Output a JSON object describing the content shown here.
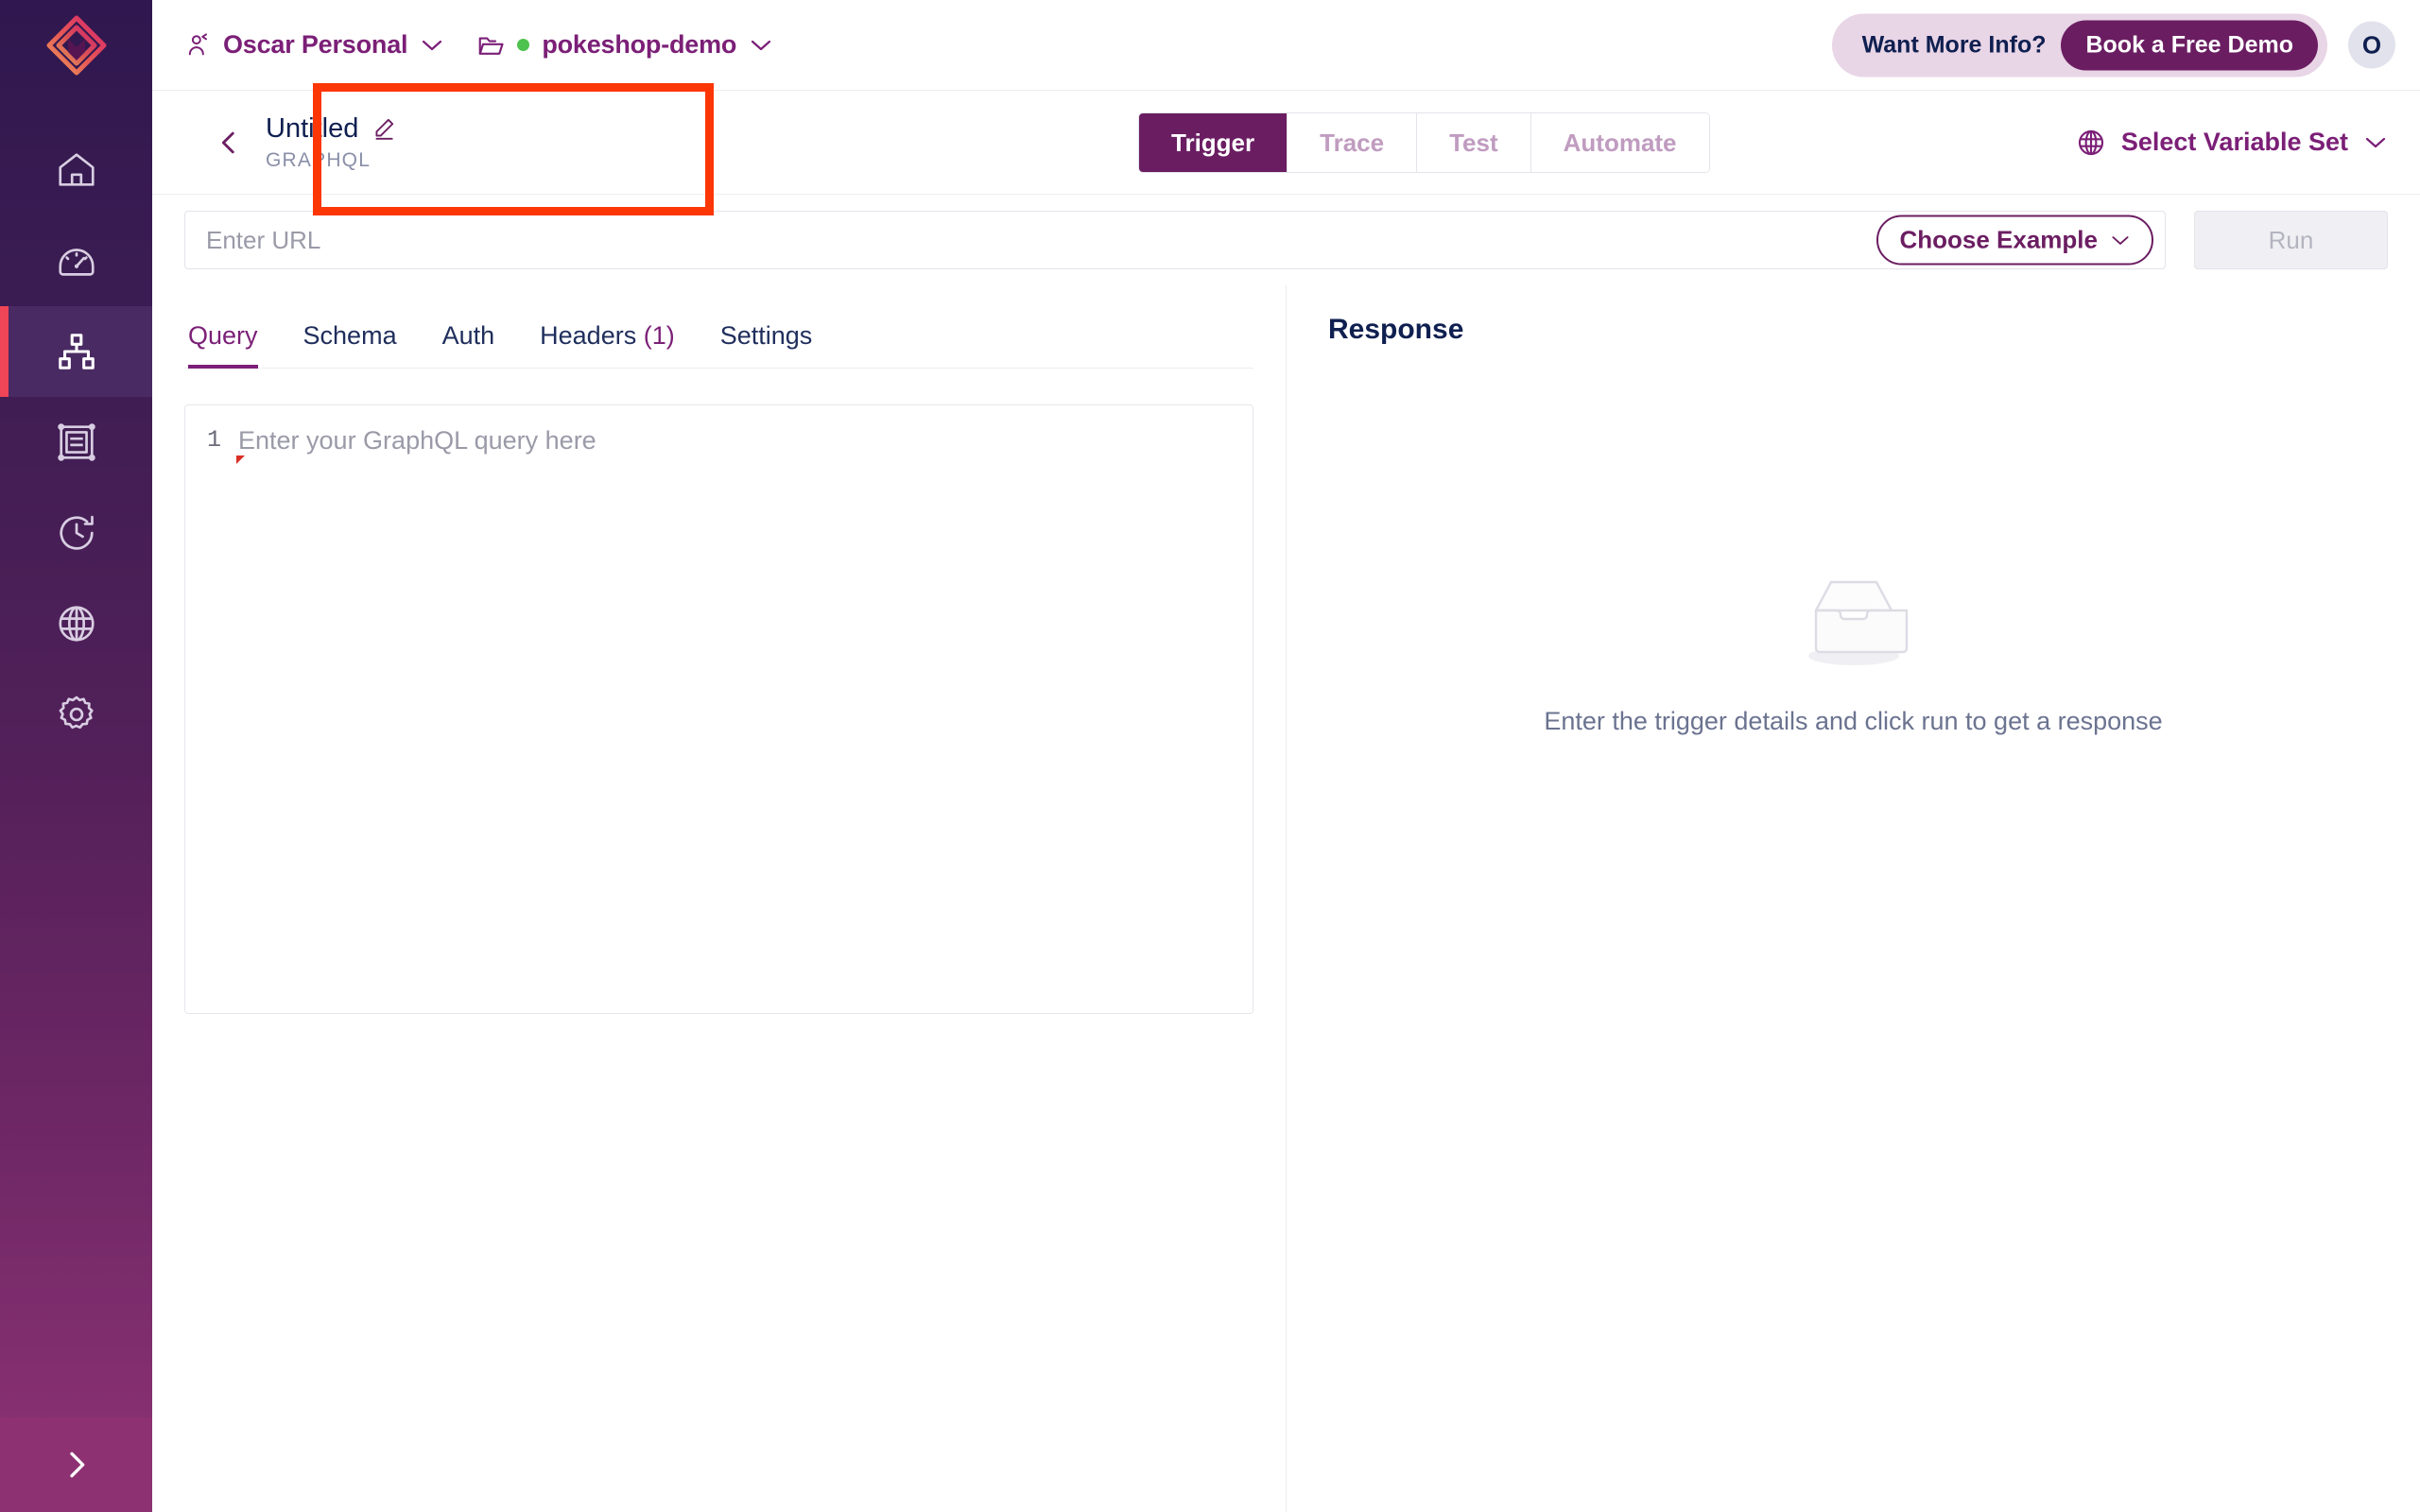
{
  "sidebar": {
    "logo_name": "tracetest-logo",
    "items": [
      {
        "name": "home",
        "icon": "home-icon",
        "active": false
      },
      {
        "name": "dashboard",
        "icon": "gauge-icon",
        "active": false
      },
      {
        "name": "tests",
        "icon": "sitemap-icon",
        "active": true
      },
      {
        "name": "test-suites",
        "icon": "grid-panel-icon",
        "active": false
      },
      {
        "name": "run-history",
        "icon": "clock-history-icon",
        "active": false
      },
      {
        "name": "environments",
        "icon": "globe-icon",
        "active": false
      },
      {
        "name": "settings",
        "icon": "gear-icon",
        "active": false
      }
    ],
    "expand_icon": "chevron-right-icon"
  },
  "topbar": {
    "organization": "Oscar Personal",
    "environment": "pokeshop-demo",
    "org_icon": "person-icon",
    "folder_icon": "folder-icon",
    "status_dot_color": "#4ec24e",
    "promo_text": "Want More Info?",
    "promo_button": "Book a Free Demo",
    "avatar_initial": "O"
  },
  "subheader": {
    "back_icon": "chevron-left-icon",
    "title": "Untitled",
    "edit_icon": "pencil-edit-icon",
    "subtitle": "GRAPHQL",
    "tabs": [
      {
        "label": "Trigger",
        "active": true
      },
      {
        "label": "Trace",
        "active": false
      },
      {
        "label": "Test",
        "active": false
      },
      {
        "label": "Automate",
        "active": false
      }
    ],
    "variable_set_label": "Select Variable Set",
    "variable_set_icon": "globe-icon",
    "variable_set_chevron": "chevron-down-icon"
  },
  "urlbar": {
    "url_value": "",
    "url_placeholder": "Enter URL",
    "choose_example_label": "Choose Example",
    "choose_example_chevron": "chevron-down-icon",
    "run_label": "Run"
  },
  "request": {
    "tabs": [
      {
        "label": "Query",
        "count": "",
        "active": true
      },
      {
        "label": "Schema",
        "count": "",
        "active": false
      },
      {
        "label": "Auth",
        "count": "",
        "active": false
      },
      {
        "label": "Headers",
        "count": "(1)",
        "active": false
      },
      {
        "label": "Settings",
        "count": "",
        "active": false
      }
    ],
    "editor": {
      "line_number": "1",
      "placeholder": "Enter your GraphQL query here"
    }
  },
  "response": {
    "title": "Response",
    "empty_icon": "empty-tray-icon",
    "empty_message": "Enter the trigger details and click run to get a response"
  },
  "annotation": {
    "color": "#fd3605",
    "target": "test-title-block"
  },
  "colors": {
    "brand_purple": "#6b1d62",
    "link_purple": "#7b1f77",
    "navy": "#0f1f50",
    "accent_red": "#f04556",
    "annotation_red": "#fd3605"
  }
}
